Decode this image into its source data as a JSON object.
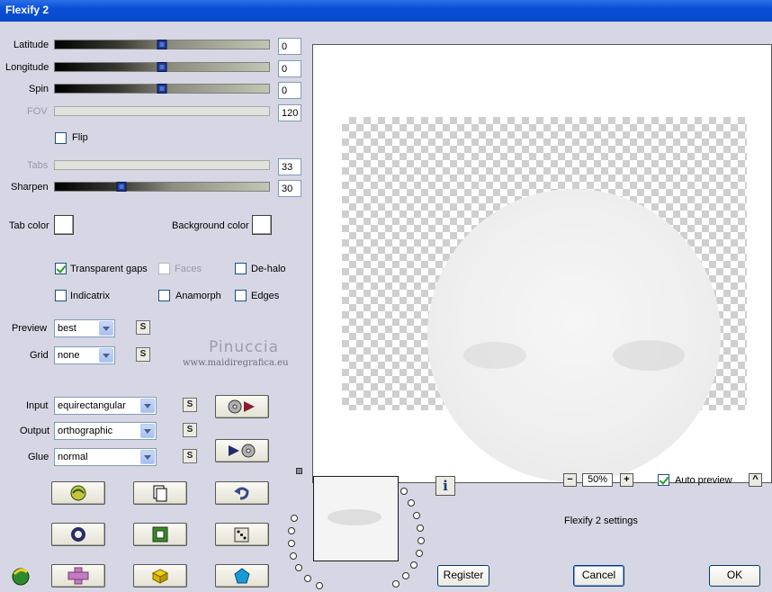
{
  "window": {
    "title": "Flexify 2"
  },
  "sliders": {
    "latitude": {
      "label": "Latitude",
      "value": "0",
      "fraction": 0.5
    },
    "longitude": {
      "label": "Longitude",
      "value": "0",
      "fraction": 0.5
    },
    "spin": {
      "label": "Spin",
      "value": "0",
      "fraction": 0.5
    },
    "fov": {
      "label": "FOV",
      "value": "120"
    },
    "tabs": {
      "label": "Tabs",
      "value": "33"
    },
    "sharpen": {
      "label": "Sharpen",
      "value": "30",
      "fraction": 0.3
    }
  },
  "flip": {
    "label": "Flip",
    "checked": false
  },
  "colors": {
    "tab_color_label": "Tab color",
    "background_color_label": "Background color",
    "tab_color": "#ffffff",
    "background_color": "#ffffff"
  },
  "options": {
    "transparent_gaps": {
      "label": "Transparent gaps",
      "checked": true
    },
    "faces": {
      "label": "Faces",
      "checked": false
    },
    "de_halo": {
      "label": "De-halo",
      "checked": false
    },
    "indicatrix": {
      "label": "Indicatrix",
      "checked": false
    },
    "anamorph": {
      "label": "Anamorph",
      "checked": false
    },
    "edges": {
      "label": "Edges",
      "checked": false
    }
  },
  "preview_select": {
    "label": "Preview",
    "value": "best"
  },
  "grid_select": {
    "label": "Grid",
    "value": "none"
  },
  "watermark": {
    "name": "Pinuccia",
    "url": "www.maidiregrafica.eu"
  },
  "projection": {
    "input": {
      "label": "Input",
      "value": "equirectangular"
    },
    "output": {
      "label": "Output",
      "value": "orthographic"
    },
    "glue": {
      "label": "Glue",
      "value": "normal"
    }
  },
  "s_button_label": "S",
  "zoom": {
    "value": "50%",
    "minus": "−",
    "plus": "+"
  },
  "auto_preview": {
    "label": "Auto preview",
    "checked": true,
    "caret": "^"
  },
  "info_label": "i",
  "settings_text": "Flexify 2 settings",
  "buttons": {
    "register": "Register",
    "cancel": "Cancel",
    "ok": "OK"
  }
}
